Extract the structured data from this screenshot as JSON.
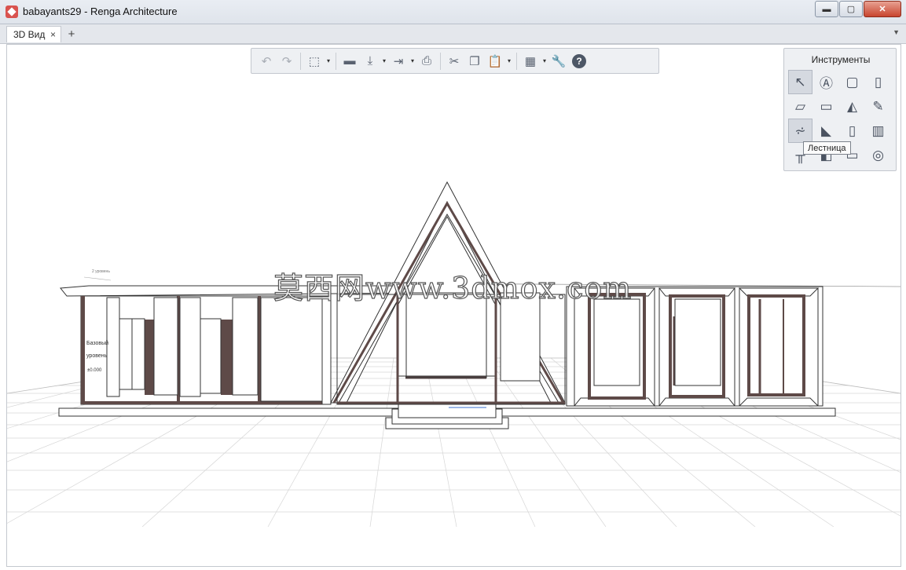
{
  "window": {
    "title": "babayants29 - Renga Architecture",
    "minimize_label": "▬",
    "maximize_label": "▢",
    "close_label": "✕"
  },
  "tabs": [
    {
      "label": "3D Вид",
      "close": "×"
    }
  ],
  "add_tab_label": "+",
  "tab_menu_label": "▼",
  "toolbar": {
    "dropdown_glyph": "▾",
    "buttons": [
      {
        "icon": "undo-icon",
        "glyph": "↶"
      },
      {
        "icon": "redo-icon",
        "glyph": "↷"
      },
      {
        "icon": "view-cube-icon",
        "glyph": "⬚"
      },
      {
        "icon": "open-folder-icon",
        "glyph": "▬"
      },
      {
        "icon": "import-icon",
        "glyph": "⤓"
      },
      {
        "icon": "export-icon",
        "glyph": "⇥"
      },
      {
        "icon": "print-icon",
        "glyph": "⎙"
      },
      {
        "icon": "cut-icon",
        "glyph": "✂"
      },
      {
        "icon": "copy-icon",
        "glyph": "❐"
      },
      {
        "icon": "paste-icon",
        "glyph": "📋"
      },
      {
        "icon": "properties-icon",
        "glyph": "▦"
      },
      {
        "icon": "wrench-icon",
        "glyph": "🔧"
      },
      {
        "icon": "help-icon",
        "glyph": "?"
      }
    ]
  },
  "tools_panel": {
    "title": "Инструменты",
    "tools": [
      {
        "icon": "select-cursor-icon",
        "glyph": "↖",
        "active": true
      },
      {
        "icon": "annotation-icon",
        "glyph": "Ⓐ"
      },
      {
        "icon": "column-icon",
        "glyph": "▢"
      },
      {
        "icon": "beam-icon",
        "glyph": "▯"
      },
      {
        "icon": "floor-slab-icon",
        "glyph": "▱"
      },
      {
        "icon": "opening-icon",
        "glyph": "▭"
      },
      {
        "icon": "roof-icon",
        "glyph": "◭"
      },
      {
        "icon": "pencil-icon",
        "glyph": "✎"
      },
      {
        "icon": "stair-icon",
        "glyph": "⩫",
        "active": true
      },
      {
        "icon": "ramp-icon",
        "glyph": "◣"
      },
      {
        "icon": "door-icon",
        "glyph": "▯"
      },
      {
        "icon": "window-icon",
        "glyph": "▥"
      },
      {
        "icon": "railing-icon",
        "glyph": "╥"
      },
      {
        "icon": "block-icon",
        "glyph": "◧"
      },
      {
        "icon": "element-icon",
        "glyph": "▭"
      },
      {
        "icon": "equipment-icon",
        "glyph": "◎"
      }
    ],
    "tooltip": "Лестница"
  },
  "scene": {
    "level_label_line1": "Базовый",
    "level_label_line2": "уровень",
    "level_mark": "±0.000",
    "level_small": "2 уровень",
    "colors": {
      "wall_dark": "#5e4a48",
      "line": "#333333",
      "grid": "#d9d9d9"
    }
  },
  "watermark": "莫西网www.3dmox.com"
}
